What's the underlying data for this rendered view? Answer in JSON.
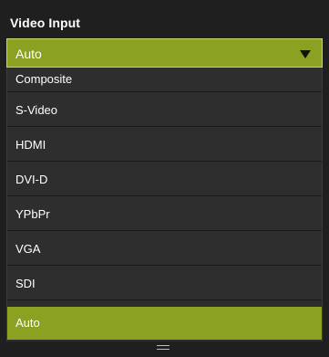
{
  "panel": {
    "title": "Video Input"
  },
  "select": {
    "value": "Auto",
    "caret_icon": "caret-down-icon"
  },
  "dropdown": {
    "options": [
      {
        "label": "Composite",
        "selected": false
      },
      {
        "label": "S-Video",
        "selected": false
      },
      {
        "label": "HDMI",
        "selected": false
      },
      {
        "label": "DVI-D",
        "selected": false
      },
      {
        "label": "YPbPr",
        "selected": false
      },
      {
        "label": "VGA",
        "selected": false
      },
      {
        "label": "SDI",
        "selected": false
      },
      {
        "label": "Auto",
        "selected": true
      }
    ],
    "resize_icon": "resize-grip-icon"
  },
  "colors": {
    "accent": "#8aa121",
    "background": "#1f1f1f",
    "item_background": "#2e2e2e",
    "text": "#ffffff"
  }
}
